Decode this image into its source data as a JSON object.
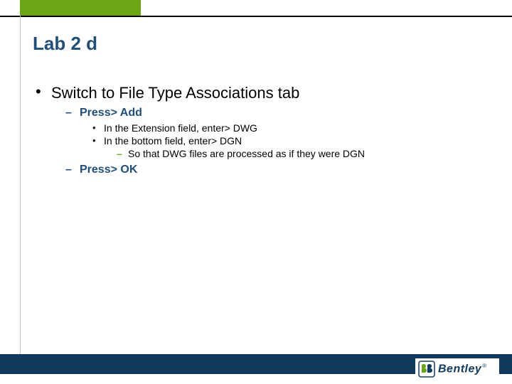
{
  "title": "Lab 2 d",
  "bullets": {
    "lvl1_0": "Switch to File Type Associations tab",
    "lvl2_0": "Press> Add",
    "lvl3_0": "In the Extension field, enter> DWG",
    "lvl3_1": "In the bottom field, enter> DGN",
    "lvl4_0": "So that DWG files are processed as if they were DGN",
    "lvl2_1": "Press> OK"
  },
  "logo": {
    "text": "Bentley",
    "reg": "®"
  }
}
